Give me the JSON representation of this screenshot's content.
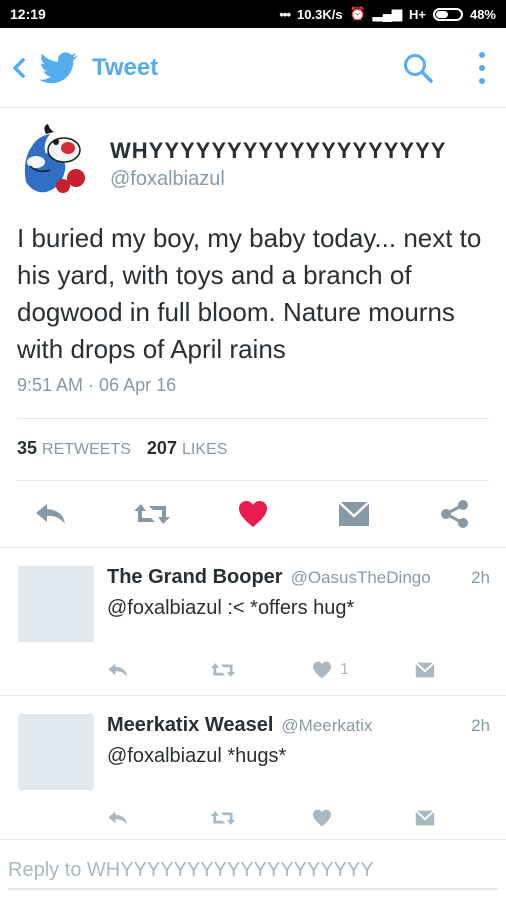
{
  "status_bar": {
    "time": "12:19",
    "network_speed": "10.3K/s",
    "network_type": "H+",
    "battery": "48%"
  },
  "app_bar": {
    "title": "Tweet",
    "icons": [
      "back-icon",
      "twitter-bird-icon",
      "search-icon",
      "more-vertical-icon"
    ],
    "accent_color": "#55acee"
  },
  "tweet": {
    "name": "WHYYYYYYYYYYYYYYYYYYY",
    "handle": "@foxalbiazul",
    "text": "I buried my boy, my baby today... next to his yard, with toys and a branch of dogwood in full bloom. Nature mourns with drops of April rains",
    "timestamp": "9:51 AM · 06 Apr 16",
    "retweets_count": "35",
    "retweets_label": "RETWEETS",
    "likes_count": "207",
    "likes_label": "LIKES",
    "liked": true,
    "like_color": "#e81c4f"
  },
  "replies": [
    {
      "name": "The Grand Booper",
      "handle": "@OasusTheDingo",
      "time": "2h",
      "text": "@foxalbiazul :< *offers hug*",
      "like_count": "1"
    },
    {
      "name": "Meerkatix Weasel",
      "handle": "@Meerkatix",
      "time": "2h",
      "text": "@foxalbiazul *hugs*",
      "like_count": ""
    }
  ],
  "compose": {
    "placeholder": "Reply to WHYYYYYYYYYYYYYYYYYYY"
  }
}
